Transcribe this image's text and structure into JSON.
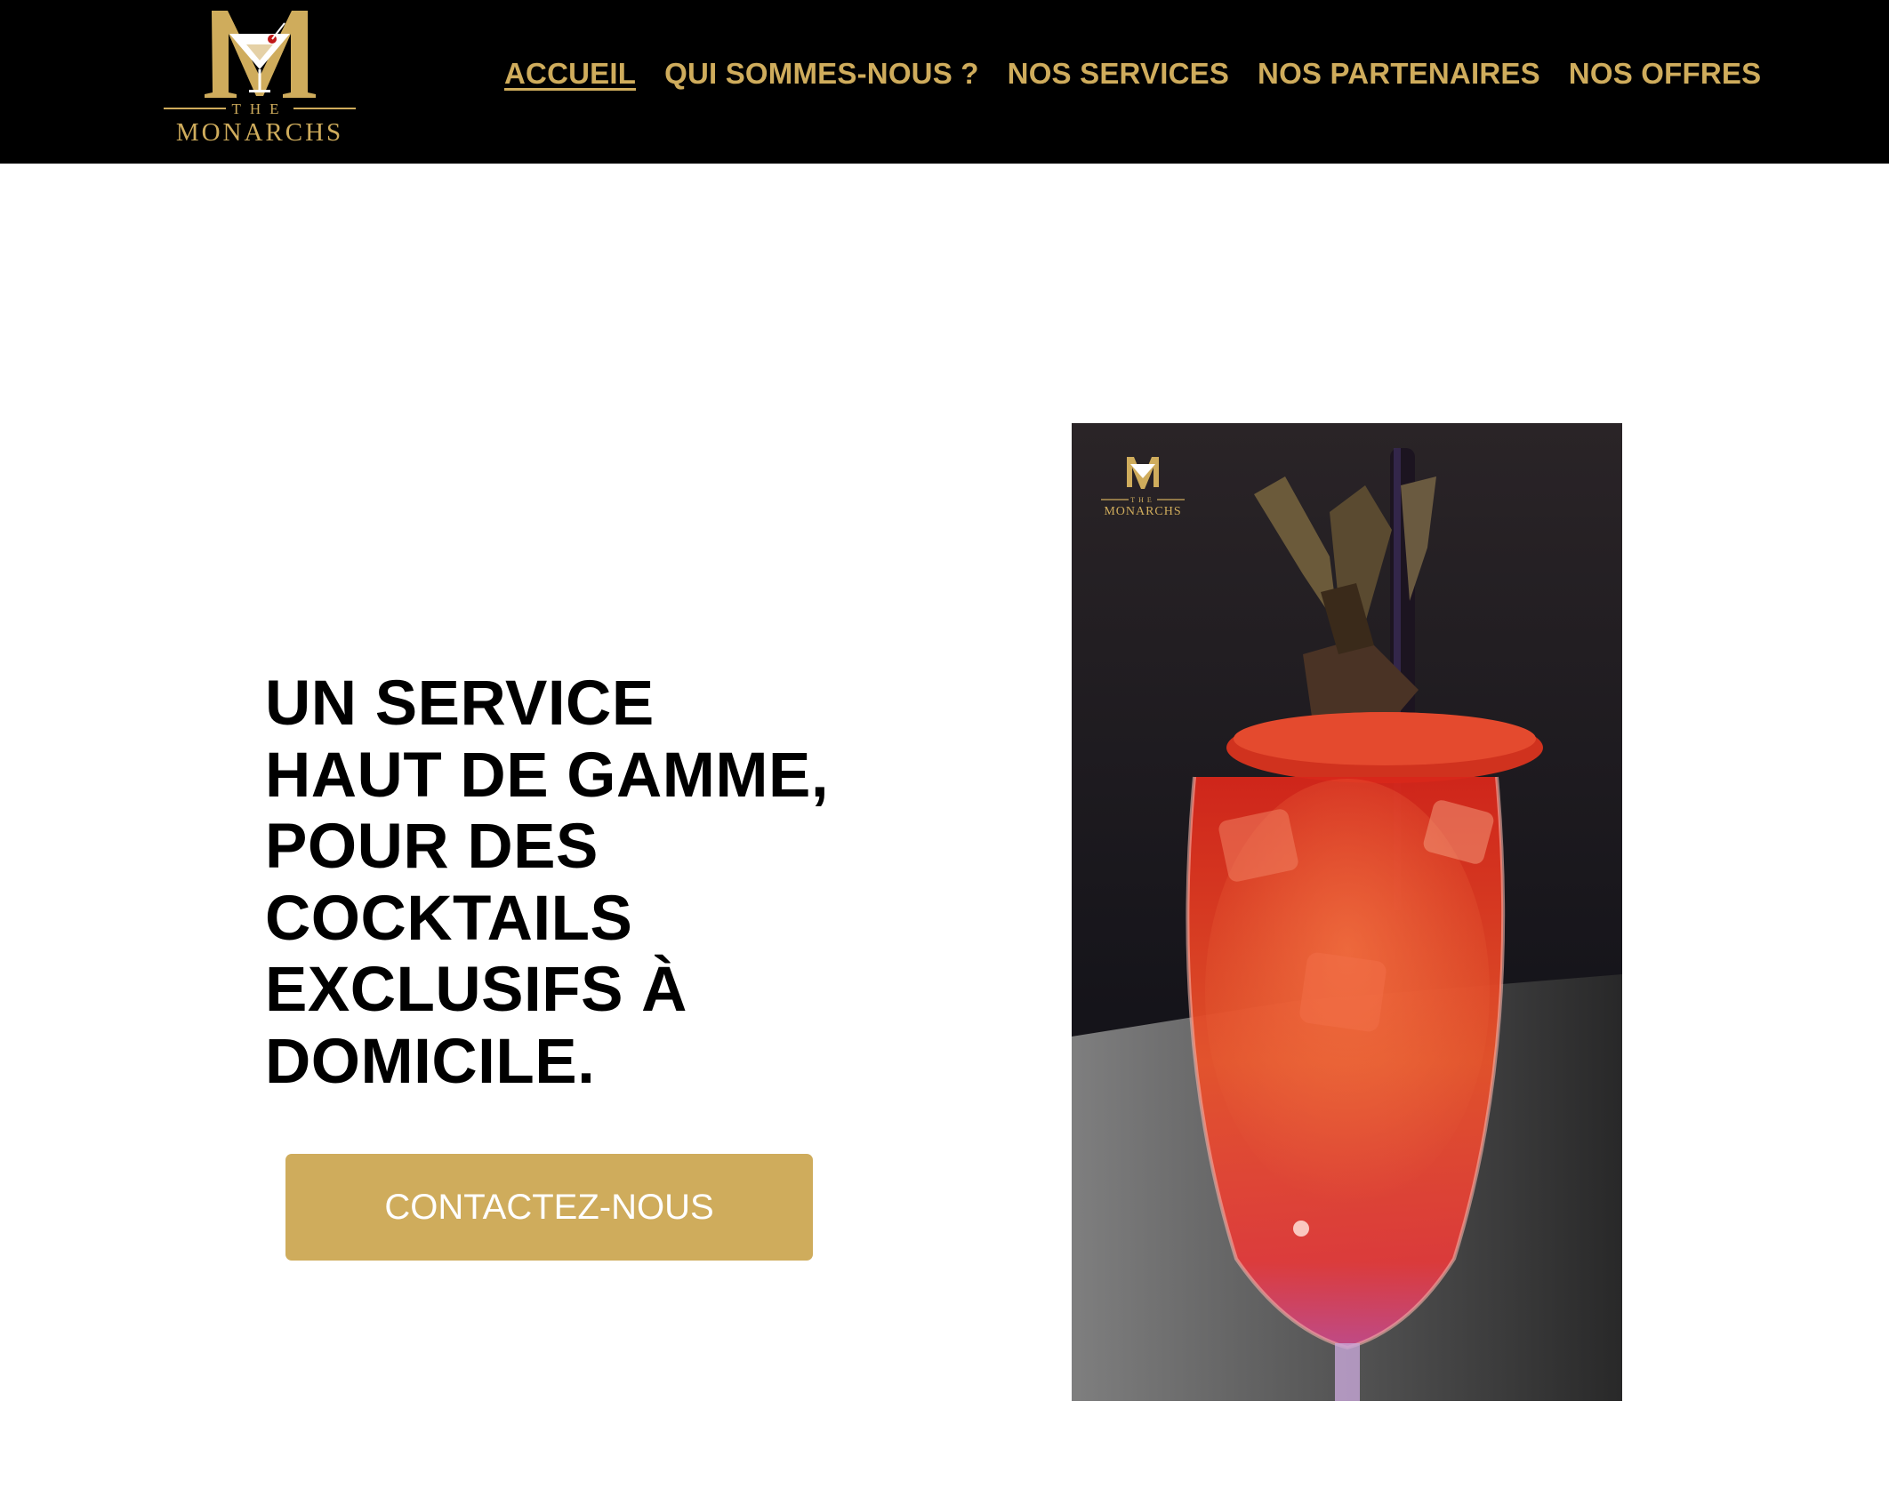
{
  "brand": {
    "logo_small_text": "THE",
    "logo_name": "MONARCHS",
    "gold": "#cfac5c",
    "black": "#000000"
  },
  "nav": {
    "items": [
      {
        "label": "ACCUEIL",
        "active": true
      },
      {
        "label": "QUI SOMMES-NOUS ?",
        "active": false
      },
      {
        "label": "NOS SERVICES",
        "active": false
      },
      {
        "label": "NOS PARTENAIRES",
        "active": false
      },
      {
        "label": "NOS OFFRES",
        "active": false
      }
    ]
  },
  "hero": {
    "headline_lines": [
      "UN SERVICE",
      "HAUT DE GAMME,",
      "POUR DES",
      "COCKTAILS",
      "EXCLUSIFS À",
      "DOMICILE."
    ],
    "cta_label": "CONTACTEZ-NOUS"
  },
  "photo": {
    "subject": "red-cocktail-glass",
    "watermark_small_text": "THE",
    "watermark_name": "MONARCHS"
  }
}
